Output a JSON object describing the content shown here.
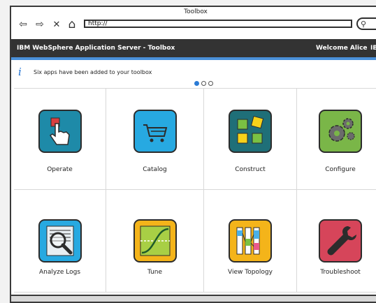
{
  "window": {
    "title": "Toolbox"
  },
  "nav": {
    "back_glyph": "⇦",
    "forward_glyph": "⇨",
    "stop_glyph": "✕",
    "home_glyph": "⌂",
    "url": "http://",
    "search_glyph": "⚲"
  },
  "appbar": {
    "title": "IBM WebSphere Application Server - Toolbox",
    "welcome": "Welcome Alice",
    "brand": "IB"
  },
  "info": {
    "icon_glyph": "i",
    "message": "Six apps have been added to your toolbox"
  },
  "pager": {
    "pages": 3,
    "active": 1
  },
  "tiles": [
    {
      "label": "Operate",
      "icon": "hand-pointer-icon",
      "bg": "#1e8aa8"
    },
    {
      "label": "Catalog",
      "icon": "cart-icon",
      "bg": "#27a9e1"
    },
    {
      "label": "Construct",
      "icon": "blocks-icon",
      "bg": "#1f6f78"
    },
    {
      "label": "Configure",
      "icon": "gears-icon",
      "bg": "#7ab648"
    },
    {
      "label": "Analyze Logs",
      "icon": "magnifier-log-icon",
      "bg": "#27a9e1"
    },
    {
      "label": "Tune",
      "icon": "curve-icon",
      "bg": "#f4b41a"
    },
    {
      "label": "View Topology",
      "icon": "topology-icon",
      "bg": "#f4b41a"
    },
    {
      "label": "Troubleshoot",
      "icon": "wrench-icon",
      "bg": "#d6455a"
    }
  ],
  "colors": {
    "appbar_bg": "#333333",
    "accent": "#4a90d9",
    "info_icon": "#1c6fd1"
  }
}
